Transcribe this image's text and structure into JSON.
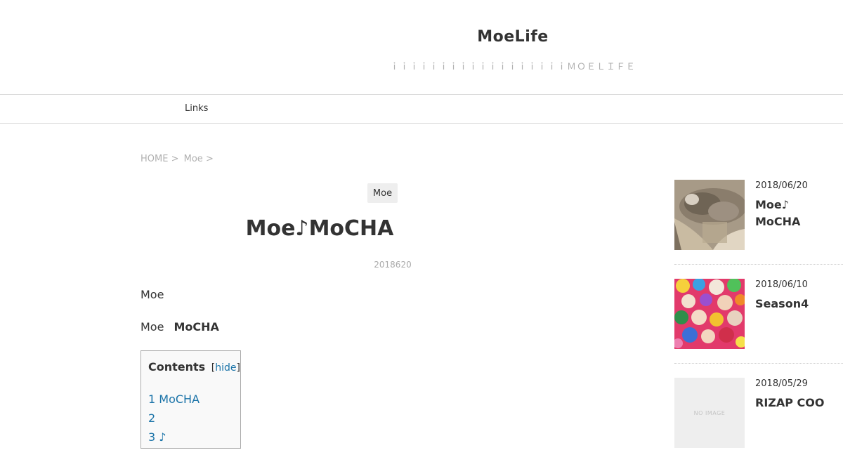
{
  "header": {
    "site_title": "MoeLife",
    "site_description": "ｉｉｉｉｉｉｉｉｉｉｉｉｉｉｉｉｉｉＭＯＥＬＩＦＥ"
  },
  "nav": {
    "items": [
      {
        "label": "Links"
      }
    ]
  },
  "breadcrumb": {
    "home": "HOME",
    "sep": ">",
    "category": "Moe"
  },
  "article": {
    "category": "Moe",
    "title": "Moe♪MoCHA",
    "date": "2018620",
    "paragraph1": "Moe",
    "paragraph2_text": "Moe",
    "paragraph2_bold": "MoCHA"
  },
  "toc": {
    "title": "Contents",
    "toggle": "hide",
    "items": [
      "1 MoCHA",
      "2",
      "3 ♪"
    ]
  },
  "sidebar": {
    "posts": [
      {
        "date": "2018/06/20",
        "title": "Moe♪ MoCHA",
        "thumb": "cat-photo"
      },
      {
        "date": "2018/06/10",
        "title": "Season4",
        "thumb": "group-photo"
      },
      {
        "date": "2018/05/29",
        "title": "RIZAP COO",
        "thumb": "no-image",
        "thumb_text": "NO IMAGE"
      }
    ]
  }
}
